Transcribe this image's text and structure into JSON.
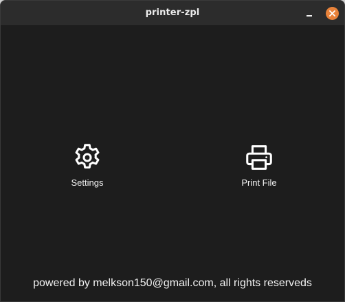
{
  "window": {
    "title": "printer-zpl"
  },
  "controls": {
    "minimize_icon": "minimize-icon",
    "close_icon": "close-icon",
    "close_color": "#e8823a"
  },
  "main": {
    "actions": [
      {
        "label": "Settings",
        "icon": "gear-icon"
      },
      {
        "label": "Print File",
        "icon": "printer-icon"
      }
    ]
  },
  "footer": {
    "text": "powered by melkson150@gmail.com, all rights reserveds"
  }
}
